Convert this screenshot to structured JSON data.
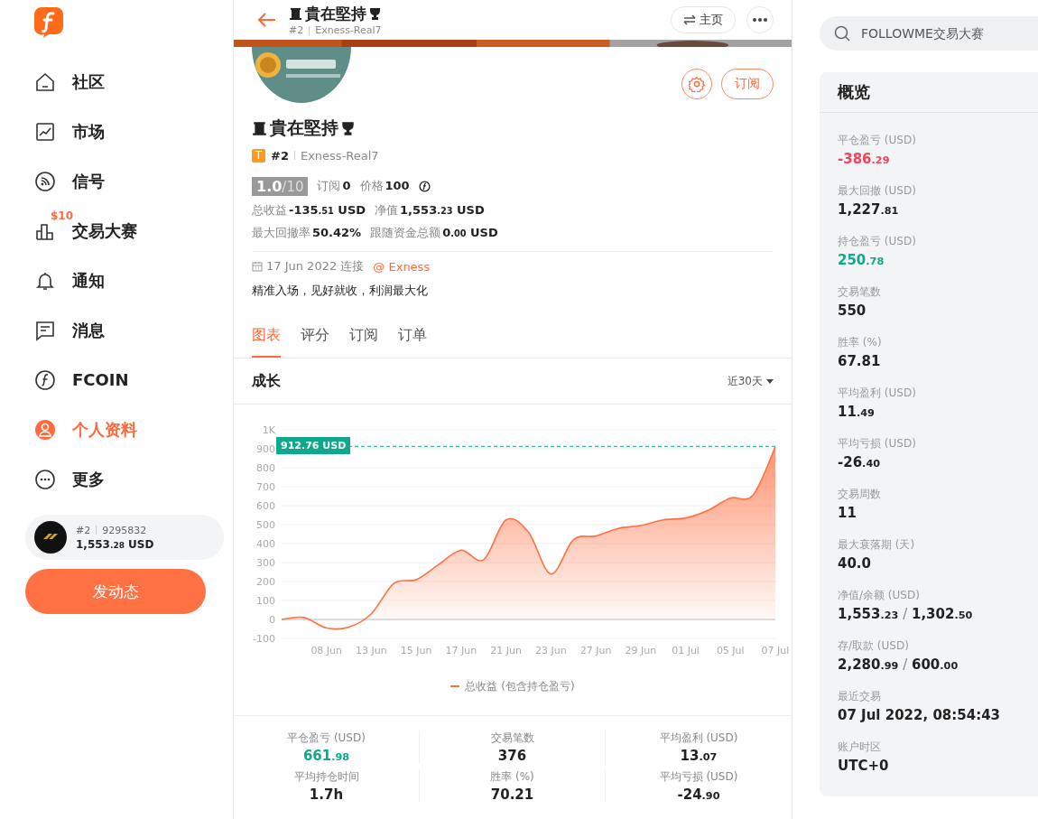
{
  "sidebar": {
    "nav": [
      {
        "kind": "home",
        "label": "社区",
        "selected": false
      },
      {
        "kind": "market",
        "label": "市场",
        "selected": false
      },
      {
        "kind": "signal",
        "label": "信号",
        "selected": false
      },
      {
        "kind": "contest",
        "label": "交易大赛",
        "selected": false,
        "badge": "$10"
      },
      {
        "kind": "bell",
        "label": "通知",
        "selected": false
      },
      {
        "kind": "message",
        "label": "消息",
        "selected": false
      },
      {
        "kind": "coin",
        "label": "FCOIN",
        "selected": false
      },
      {
        "kind": "user",
        "label": "个人资料",
        "selected": true
      },
      {
        "kind": "more",
        "label": "更多",
        "selected": false
      }
    ],
    "account": {
      "rank": "#2",
      "id": "9295832",
      "balance": {
        "main": "1,553",
        "small": ".28",
        "unit": "USD"
      }
    },
    "post_button": "发动态"
  },
  "header": {
    "title": "貴在堅持",
    "rank": "#2",
    "server": "Exness-Real7",
    "home_button": "主页"
  },
  "profile": {
    "subscribe_button": "订阅",
    "name": "貴在堅持",
    "tier": "T",
    "rank": "#2",
    "server": "Exness-Real7",
    "rating": "1.0",
    "rating_max": "/10",
    "line1": [
      {
        "label": "订阅",
        "main": "0"
      },
      {
        "label": "价格",
        "main": "100",
        "coin": true
      }
    ],
    "line2": [
      {
        "label": "总收益",
        "main": "-135",
        "small": ".51",
        "unit": "USD"
      },
      {
        "label": "净值",
        "main": "1,553",
        "small": ".23",
        "unit": "USD"
      }
    ],
    "line3": [
      {
        "label": "最大回撤率",
        "main": "50.42%"
      },
      {
        "label": "跟随资金总额",
        "main": "0",
        "small": ".00",
        "unit": "USD"
      }
    ],
    "connected": "17 Jun 2022 连接",
    "broker": "@ Exness",
    "bio": "精准入场，见好就收，利润最大化"
  },
  "tabs": [
    {
      "label": "图表",
      "selected": true
    },
    {
      "label": "评分",
      "selected": false
    },
    {
      "label": "订阅",
      "selected": false
    },
    {
      "label": "订单",
      "selected": false
    }
  ],
  "growth": {
    "title": "成长",
    "period": "近30天",
    "chart_data": {
      "type": "area",
      "grid": true,
      "ref_lines": [
        {
          "axis": "y",
          "value": 912.76,
          "label": "912.76 USD",
          "color": "#10a88a"
        }
      ],
      "categories": [
        null,
        null,
        "08 Jun",
        null,
        "13 Jun",
        null,
        "15 Jun",
        null,
        "17 Jun",
        null,
        "21 Jun",
        null,
        "23 Jun",
        null,
        "27 Jun",
        null,
        "29 Jun",
        null,
        "01 Jul",
        null,
        "05 Jul",
        null,
        "07 Jul"
      ],
      "series": [
        {
          "name": "总收益 (包含持仓盈亏)",
          "color": "#ff7043",
          "values": [
            0,
            10,
            -45,
            -40,
            30,
            190,
            210,
            290,
            365,
            315,
            525,
            460,
            240,
            420,
            440,
            480,
            495,
            525,
            535,
            575,
            640,
            655,
            910
          ]
        }
      ],
      "ylim": [
        -100,
        1000
      ],
      "yticks": [
        -100,
        0,
        100,
        200,
        300,
        400,
        500,
        600,
        700,
        800,
        900,
        {
          "value": 1000,
          "label": "1K"
        }
      ]
    }
  },
  "summary": [
    {
      "label": "平仓盈亏 (USD)",
      "main": "661",
      "small": ".98",
      "color": "#10a88a"
    },
    {
      "label": "交易笔数",
      "main": "376",
      "color": "#222222"
    },
    {
      "label": "平均盈利 (USD)",
      "main": "13",
      "small": ".07",
      "color": "#222222"
    },
    {
      "label": "平均持仓时间",
      "main": "1.7h",
      "color": "#222222"
    },
    {
      "label": "胜率 (%)",
      "main": "70.21",
      "color": "#222222"
    },
    {
      "label": "平均亏损 (USD)",
      "main": "-24",
      "small": ".90",
      "color": "#222222"
    }
  ],
  "search": {
    "placeholder": "FOLLOWME交易大赛"
  },
  "overview": {
    "title": "概览",
    "items": [
      {
        "label": "平仓盈亏 (USD)",
        "color": "#f0445a",
        "parts": [
          {
            "main": "-386",
            "small": ".29"
          }
        ]
      },
      {
        "label": "最大回撤 (USD)",
        "color": "#222222",
        "parts": [
          {
            "main": "1,227",
            "small": ".81"
          }
        ]
      },
      {
        "label": "持仓盈亏 (USD)",
        "color": "#10a88a",
        "parts": [
          {
            "main": "250",
            "small": ".78"
          }
        ]
      },
      {
        "label": "交易笔数",
        "color": "#222222",
        "parts": [
          {
            "main": "550"
          }
        ]
      },
      {
        "label": "胜率 (%)",
        "color": "#222222",
        "parts": [
          {
            "main": "67.81"
          }
        ]
      },
      {
        "label": "平均盈利 (USD)",
        "color": "#222222",
        "parts": [
          {
            "main": "11",
            "small": ".49"
          }
        ]
      },
      {
        "label": "平均亏损 (USD)",
        "color": "#222222",
        "parts": [
          {
            "main": "-26",
            "small": ".40"
          }
        ]
      },
      {
        "label": "交易周数",
        "color": "#222222",
        "parts": [
          {
            "main": "11"
          }
        ]
      },
      {
        "label": "最大衰落期 (天)",
        "color": "#222222",
        "parts": [
          {
            "main": "40.0"
          }
        ]
      },
      {
        "label": "净值/余额 (USD)",
        "color": "#222222",
        "separator": "/",
        "parts": [
          {
            "main": "1,553",
            "small": ".23"
          },
          {
            "main": "1,302",
            "small": ".50"
          }
        ]
      },
      {
        "label": "存/取款 (USD)",
        "color": "#222222",
        "separator": "/",
        "parts": [
          {
            "main": "2,280",
            "small": ".99"
          },
          {
            "main": "600",
            "small": ".00"
          }
        ]
      },
      {
        "label": "最近交易",
        "color": "#222222",
        "parts": [
          {
            "main": "07 Jul 2022, 08:54:43"
          }
        ]
      },
      {
        "label": "账户时区",
        "color": "#222222",
        "parts": [
          {
            "main": "UTC+0"
          }
        ]
      }
    ]
  }
}
